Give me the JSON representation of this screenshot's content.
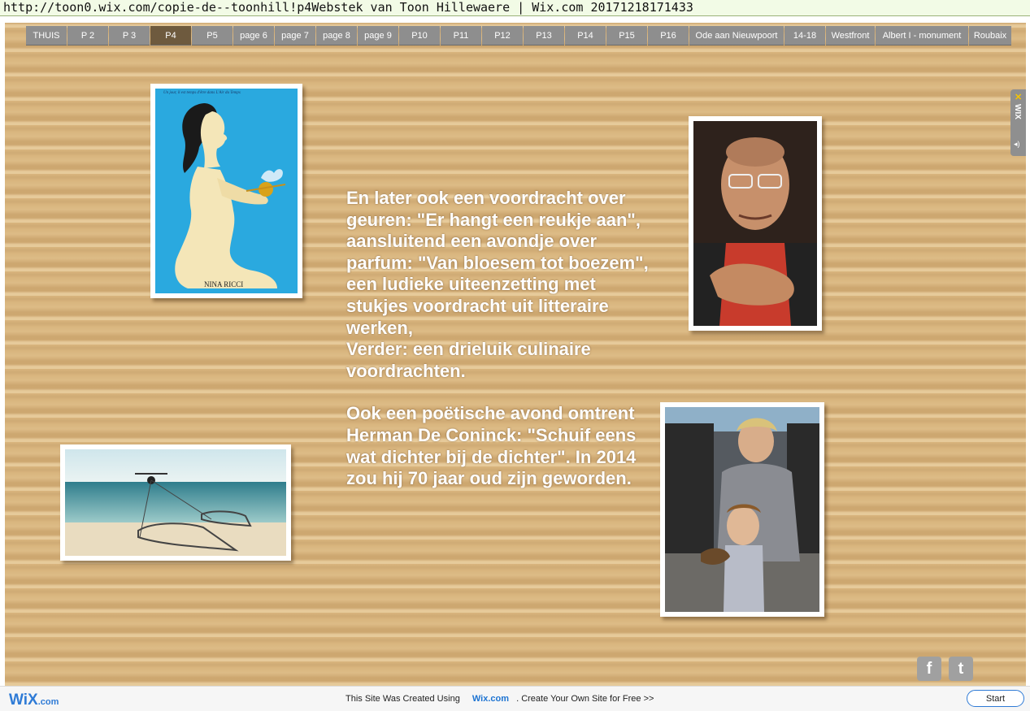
{
  "archive_bar": {
    "text": "http://toon0.wix.com/copie-de--toonhill!p4Webstek van Toon Hillewaere | Wix.com 20171218171433"
  },
  "nav": {
    "items": [
      "THUIS",
      "P 2",
      "P 3",
      "P4",
      "P5",
      "page 6",
      "page 7",
      "page 8",
      "page 9",
      "P10",
      "P11",
      "P12",
      "P13",
      "P14",
      "P15",
      "P16",
      "Ode aan Nieuwpoort",
      "14-18",
      "Westfront",
      "Albert  I - monument",
      "Roubaix"
    ],
    "active": "P4"
  },
  "content": {
    "paragraph1": " En later ook een voordracht over geuren: \"Er hangt een reukje aan\", aansluitend een avondje over parfum: \"Van bloesem tot boezem\", een ludieke uiteenzetting met stukjes voordracht uit litteraire werken,",
    "paragraph2": "Verder: een drieluik culinaire voordrachten.",
    "paragraph3": "Ook een poëtische avond omtrent Herman De Coninck: \"Schuif eens wat dichter bij de dichter\". In 2014 zou hij 70 jaar oud zijn geworden."
  },
  "poster": {
    "tagline": "Un jour, il est temps d'être dans L'Air du Temps",
    "brand": "NINA RICCI"
  },
  "side_tab": {
    "label": "WIX"
  },
  "social": {
    "facebook": "f",
    "twitter": "t"
  },
  "footer": {
    "logo": "WiX",
    "logo_suffix": ".com",
    "text_before": "This Site Was Created Using",
    "link": "Wix.com",
    "text_after": ". Create Your Own Site for Free >>",
    "start_button": "Start"
  },
  "colors": {
    "page_wood": "#d9b57e",
    "nav_bg": "#8e8e8e",
    "nav_active": "#6e5a3e",
    "wix_blue": "#2f7bd6"
  }
}
